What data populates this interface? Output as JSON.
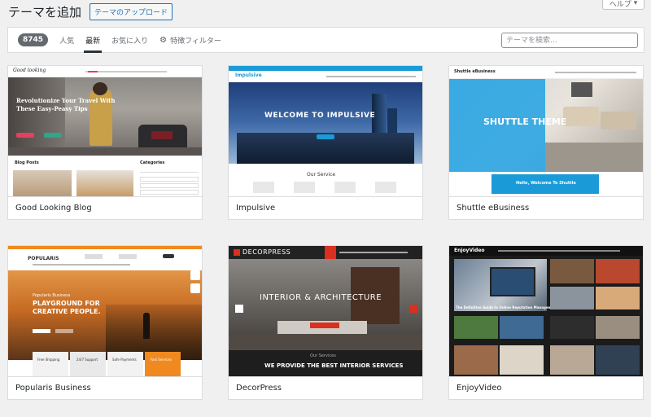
{
  "header": {
    "title": "テーマを追加",
    "upload_label": "テーマのアップロード",
    "help_label": "ヘルプ"
  },
  "filters": {
    "count": "8745",
    "tabs": [
      "人気",
      "最新",
      "お気に入り"
    ],
    "feature_filter": "特徴フィルター",
    "search_placeholder": "テーマを検索..."
  },
  "themes": [
    {
      "name": "Good Looking Blog",
      "preview": {
        "logo": "Good looking",
        "hero_text": "Revolutionize Your Travel With These Easy-Peasy Tips",
        "section_left": "Blog Posts",
        "section_right": "Categories"
      }
    },
    {
      "name": "Impulsive",
      "preview": {
        "logo": "Impulsive",
        "hero_text": "WELCOME TO IMPULSIVE",
        "section": "Our Service"
      }
    },
    {
      "name": "Shuttle eBusiness",
      "preview": {
        "logo": "Shuttle eBusiness",
        "hero_text": "SHUTTLE THEME",
        "banner": "Hello, Welcome To Shuttle"
      }
    },
    {
      "name": "Popularis Business",
      "preview": {
        "logo": "POPULARIS",
        "hero_sub": "Popularis Business",
        "hero_text": "PLAYGROUND FOR CREATIVE PEOPLE.",
        "features": [
          "Free Shipping",
          "24/7 Support",
          "Safe Payments",
          "Fast Services"
        ]
      }
    },
    {
      "name": "DecorPress",
      "preview": {
        "logo": "DECORPRESS",
        "hero_text": "INTERIOR & ARCHITECTURE",
        "footer_label": "Our Services",
        "footer_text": "WE PROVIDE THE BEST INTERIOR SERVICES"
      }
    },
    {
      "name": "EnjoyVideo",
      "preview": {
        "logo": "EnjoyVideo",
        "headline": "The Definitive Guide to Online Reputation Management"
      }
    }
  ]
}
